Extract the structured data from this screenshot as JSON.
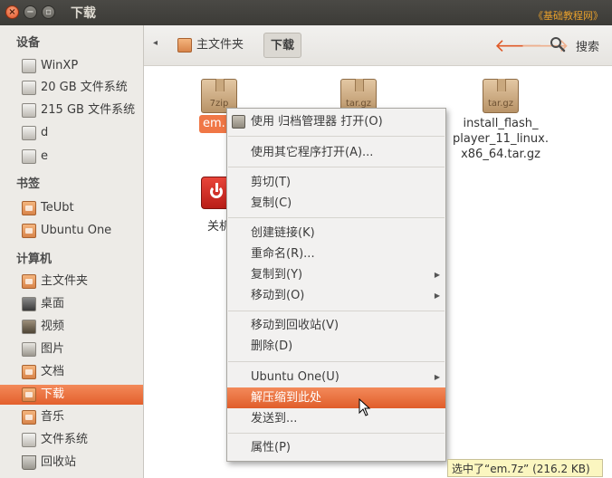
{
  "window": {
    "title": "下载",
    "watermark": "《基础教程网》"
  },
  "sidebar": {
    "sections": [
      {
        "heading": "设备",
        "items": [
          {
            "label": "WinXP",
            "icon": "drive-icon"
          },
          {
            "label": "20 GB 文件系统",
            "icon": "drive-icon"
          },
          {
            "label": "215 GB 文件系统",
            "icon": "drive-icon"
          },
          {
            "label": "d",
            "icon": "drive-icon"
          },
          {
            "label": "e",
            "icon": "drive-icon"
          }
        ]
      },
      {
        "heading": "书签",
        "items": [
          {
            "label": "TeUbt",
            "icon": "folder-icon"
          },
          {
            "label": "Ubuntu One",
            "icon": "folder-icon"
          }
        ]
      },
      {
        "heading": "计算机",
        "items": [
          {
            "label": "主文件夹",
            "icon": "home-folder-icon"
          },
          {
            "label": "桌面",
            "icon": "desktop-folder-icon"
          },
          {
            "label": "视频",
            "icon": "video-folder-icon"
          },
          {
            "label": "图片",
            "icon": "pictures-folder-icon"
          },
          {
            "label": "文档",
            "icon": "documents-folder-icon"
          },
          {
            "label": "下载",
            "icon": "downloads-folder-icon",
            "active": true
          },
          {
            "label": "音乐",
            "icon": "music-folder-icon"
          },
          {
            "label": "文件系统",
            "icon": "drive-icon"
          },
          {
            "label": "回收站",
            "icon": "trash-icon"
          }
        ]
      }
    ]
  },
  "toolbar": {
    "breadcrumbs": [
      "主文件夹",
      "下载"
    ],
    "search_label": "搜索"
  },
  "files": [
    {
      "name": "em.7z",
      "name_visible": "em.",
      "type_label": "7zip",
      "selected": true
    },
    {
      "name": "",
      "type_label": "tar.gz"
    },
    {
      "name_line1": "install_flash_",
      "name_line2": "player_11_linux.",
      "name_line3": "x86_64.tar.gz",
      "type_label": "tar.gz"
    },
    {
      "name": "关机",
      "name_visible": "关机"
    }
  ],
  "context_menu": {
    "items": [
      {
        "label": "使用 归档管理器 打开(O)",
        "has_icon": true
      },
      {
        "label": "使用其它程序打开(A)..."
      },
      {
        "label": "剪切(T)"
      },
      {
        "label": "复制(C)"
      },
      {
        "label": "创建链接(K)"
      },
      {
        "label": "重命名(R)..."
      },
      {
        "label": "复制到(Y)",
        "submenu": true
      },
      {
        "label": "移动到(O)",
        "submenu": true
      },
      {
        "label": "移动到回收站(V)"
      },
      {
        "label": "删除(D)"
      },
      {
        "label": "Ubuntu One(U)",
        "submenu": true
      },
      {
        "label": "解压缩到此处",
        "highlighted": true
      },
      {
        "label": "发送到..."
      },
      {
        "label": "属性(P)"
      }
    ]
  },
  "statusbar": {
    "text": "选中了“em.7z” (216.2 KB)"
  },
  "colors": {
    "accent": "#e35f2c",
    "titlebar": "#3c3b37",
    "status_bg": "#fbf6c0"
  }
}
